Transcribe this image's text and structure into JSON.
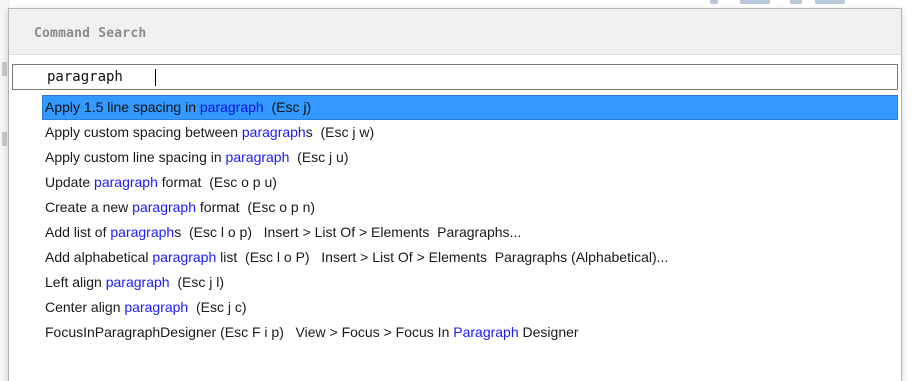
{
  "dialog": {
    "title": "Command Search"
  },
  "search": {
    "query": "paragraph"
  },
  "colors": {
    "selection": "#3399ff",
    "match_highlight": "#1a1aff",
    "header_bg": "#f0f0f0"
  },
  "results": [
    {
      "pre": "Apply 1.5 line spacing in ",
      "match": "paragraph",
      "post": "  (Esc j)",
      "selected": true
    },
    {
      "pre": "Apply custom spacing between ",
      "match": "paragraph",
      "post": "s  (Esc j w)",
      "selected": false
    },
    {
      "pre": "Apply custom line spacing in ",
      "match": "paragraph",
      "post": "  (Esc j u)",
      "selected": false
    },
    {
      "pre": "Update ",
      "match": "paragraph",
      "post": " format  (Esc o p u)",
      "selected": false
    },
    {
      "pre": "Create a new ",
      "match": "paragraph",
      "post": " format  (Esc o p n)",
      "selected": false
    },
    {
      "pre": "Add list of ",
      "match": "paragraph",
      "post": "s  (Esc l o p)   Insert > List Of > Elements  Paragraphs...",
      "selected": false
    },
    {
      "pre": "Add alphabetical ",
      "match": "paragraph",
      "post": " list  (Esc l o P)   Insert > List Of > Elements  Paragraphs (Alphabetical)...",
      "selected": false
    },
    {
      "pre": "Left align ",
      "match": "paragraph",
      "post": "  (Esc j l)",
      "selected": false
    },
    {
      "pre": "Center align ",
      "match": "paragraph",
      "post": "  (Esc j c)",
      "selected": false
    },
    {
      "pre": "FocusInParagraphDesigner (Esc F i p)   View > Focus > Focus In ",
      "match": "Paragraph",
      "post": " Designer",
      "selected": false
    }
  ]
}
